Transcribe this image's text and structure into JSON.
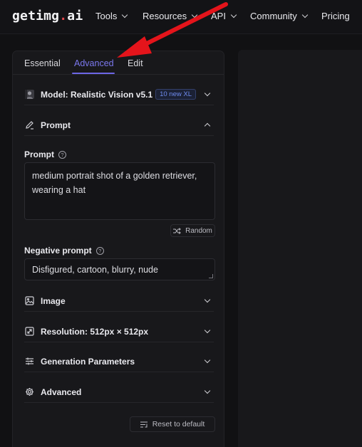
{
  "brand": {
    "name_main": "getimg",
    "name_dot": ".",
    "name_tld": "ai"
  },
  "nav": {
    "items": [
      {
        "label": "Tools"
      },
      {
        "label": "Resources"
      },
      {
        "label": "API"
      },
      {
        "label": "Community"
      },
      {
        "label": "Pricing"
      }
    ]
  },
  "tabs": [
    "Essential",
    "Advanced",
    "Edit"
  ],
  "active_tab": "Advanced",
  "model": {
    "label": "Model: Realistic Vision v5.1",
    "badge": "10 new XL"
  },
  "sections": {
    "prompt": "Prompt",
    "image": "Image",
    "resolution": "Resolution: 512px × 512px",
    "generation_parameters": "Generation Parameters",
    "advanced": "Advanced"
  },
  "prompt": {
    "label": "Prompt",
    "value": "medium portrait shot of a golden retriever, wearing a hat",
    "random_label": "Random"
  },
  "negative_prompt": {
    "label": "Negative prompt",
    "value": "Disfigured, cartoon, blurry, nude"
  },
  "reset_label": "Reset to default",
  "colors": {
    "accent": "#6c66e6",
    "background": "#111113",
    "panel": "#18181b",
    "annotation_arrow": "#e4141b",
    "logo_dot": "#e5484d"
  }
}
